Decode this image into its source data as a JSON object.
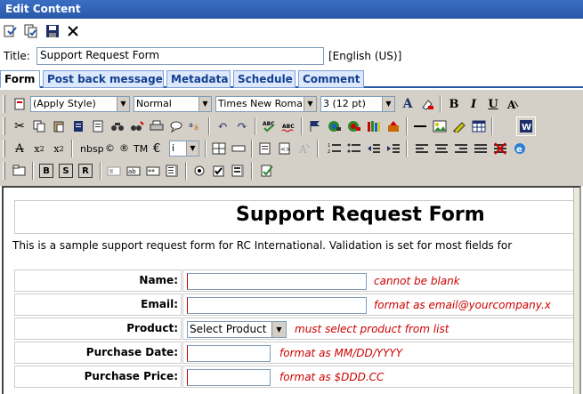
{
  "window": {
    "title": "Edit Content"
  },
  "title_row": {
    "label": "Title:",
    "value": "Support Request Form",
    "language": "[English (US)]"
  },
  "tabs": [
    {
      "label": "Form"
    },
    {
      "label": "Post back message"
    },
    {
      "label": "Metadata"
    },
    {
      "label": "Schedule"
    },
    {
      "label": "Comment"
    }
  ],
  "toolbar": {
    "style_select": "(Apply Style)",
    "format_select": "Normal",
    "font_select": "Times New Roman",
    "size_select": "3 (12 pt)",
    "bold": "B",
    "italic": "I",
    "underline": "U",
    "font_size_a": "A",
    "nbsp": "nbsp",
    "copyright": "©",
    "registered": "®",
    "tm": "TM",
    "euro": "€",
    "char_select": "i",
    "form_b": "B",
    "form_s": "S",
    "form_r": "R",
    "abc": "ABC",
    "abc2": "ABC"
  },
  "document": {
    "heading": "Support Request Form",
    "description": "This is a sample support request form for RC International. Validation is set for most fields for",
    "fields": [
      {
        "label": "Name:",
        "hint": "cannot be blank"
      },
      {
        "label": "Email:",
        "hint": "format as email@yourcompany.x"
      },
      {
        "label": "Product:",
        "select": "Select Product",
        "hint": "must select product from list"
      },
      {
        "label": "Purchase Date:",
        "hint": "format as MM/DD/YYYY"
      },
      {
        "label": "Purchase Price:",
        "hint": "format as $DDD.CC"
      }
    ]
  },
  "colors": {
    "titlebar": "#2a58a8",
    "tab_text": "#123f8f",
    "hint": "#cc0000",
    "toolbar_bg": "#d4d0c8"
  }
}
